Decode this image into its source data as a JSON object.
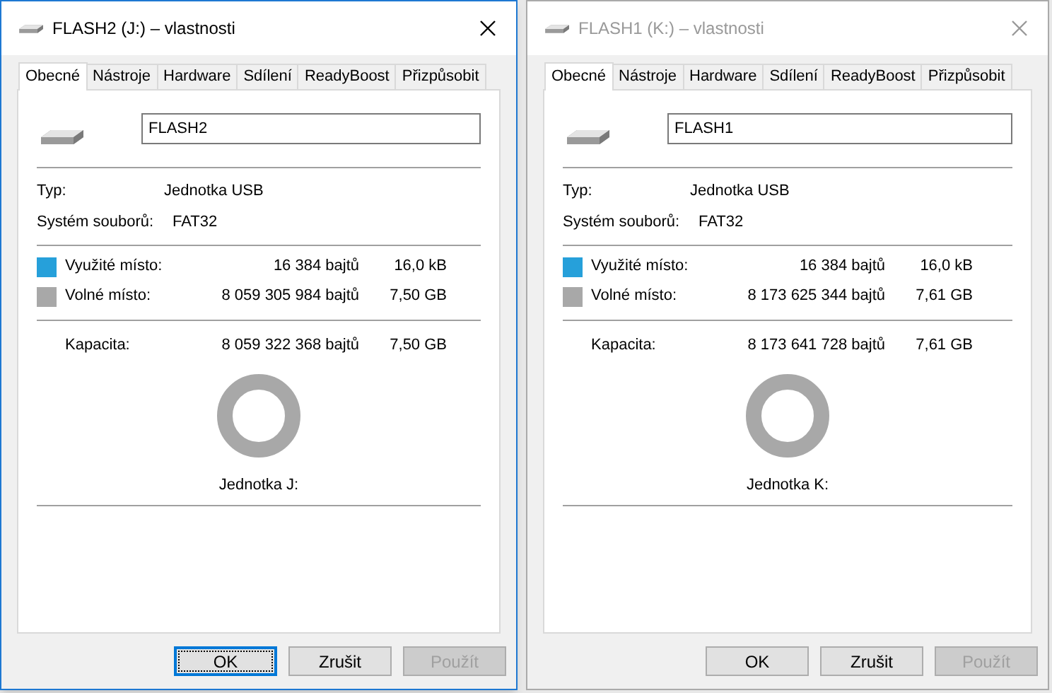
{
  "dialogs": [
    {
      "title": "FLASH2 (J:) – vlastnosti",
      "active": true,
      "tabs": [
        {
          "label": "Obecné",
          "selected": true
        },
        {
          "label": "Nástroje",
          "selected": false
        },
        {
          "label": "Hardware",
          "selected": false
        },
        {
          "label": "Sdílení",
          "selected": false
        },
        {
          "label": "ReadyBoost",
          "selected": false
        },
        {
          "label": "Přizpůsobit",
          "selected": false
        }
      ],
      "name_value": "FLASH2",
      "type_label": "Typ:",
      "type_value": "Jednotka USB",
      "fs_label": "Systém souborů:",
      "fs_value": "FAT32",
      "space": [
        {
          "label": "Využité místo:",
          "bytes": "16 384 bajtů",
          "size": "16,0 kB",
          "color": "#26a0da"
        },
        {
          "label": "Volné místo:",
          "bytes": "8 059 305 984 bajtů",
          "size": "7,50 GB",
          "color": "#a8a8a8"
        }
      ],
      "capacity": {
        "label": "Kapacita:",
        "bytes": "8 059 322 368 bajtů",
        "size": "7,50 GB"
      },
      "drive_label": "Jednotka J:",
      "buttons": [
        {
          "label": "OK",
          "focused": true,
          "disabled": false
        },
        {
          "label": "Zrušit",
          "focused": false,
          "disabled": false
        },
        {
          "label": "Použít",
          "focused": false,
          "disabled": true
        }
      ]
    },
    {
      "title": "FLASH1 (K:) – vlastnosti",
      "active": false,
      "tabs": [
        {
          "label": "Obecné",
          "selected": true
        },
        {
          "label": "Nástroje",
          "selected": false
        },
        {
          "label": "Hardware",
          "selected": false
        },
        {
          "label": "Sdílení",
          "selected": false
        },
        {
          "label": "ReadyBoost",
          "selected": false
        },
        {
          "label": "Přizpůsobit",
          "selected": false
        }
      ],
      "name_value": "FLASH1",
      "type_label": "Typ:",
      "type_value": "Jednotka USB",
      "fs_label": "Systém souborů:",
      "fs_value": "FAT32",
      "space": [
        {
          "label": "Využité místo:",
          "bytes": "16 384 bajtů",
          "size": "16,0 kB",
          "color": "#26a0da"
        },
        {
          "label": "Volné místo:",
          "bytes": "8 173 625 344 bajtů",
          "size": "7,61 GB",
          "color": "#a8a8a8"
        }
      ],
      "capacity": {
        "label": "Kapacita:",
        "bytes": "8 173 641 728 bajtů",
        "size": "7,61 GB"
      },
      "drive_label": "Jednotka K:",
      "buttons": [
        {
          "label": "OK",
          "focused": false,
          "disabled": false
        },
        {
          "label": "Zrušit",
          "focused": false,
          "disabled": false
        },
        {
          "label": "Použít",
          "focused": false,
          "disabled": true
        }
      ]
    }
  ]
}
